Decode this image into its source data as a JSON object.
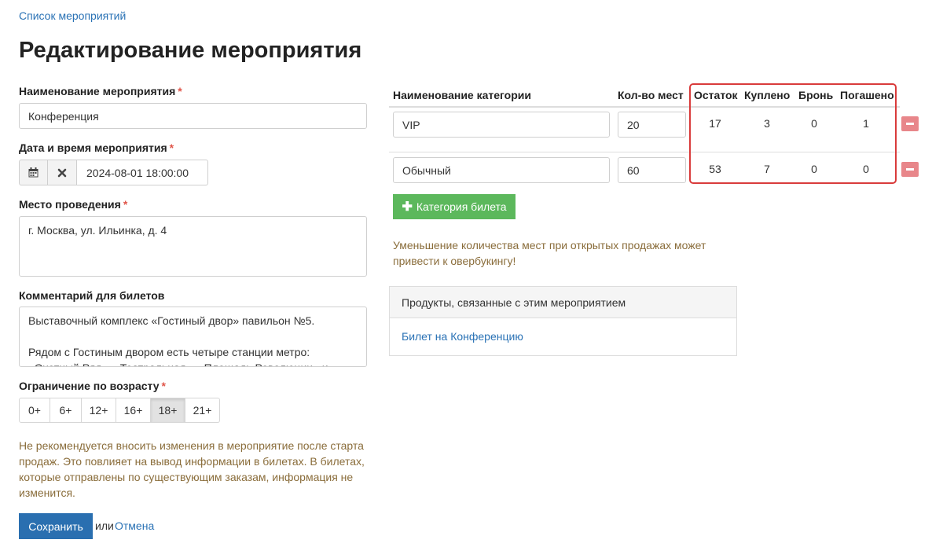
{
  "breadcrumb": "Список мероприятий",
  "page_title": "Редактирование мероприятия",
  "required_mark": "*",
  "form": {
    "name_label": "Наименование мероприятия",
    "name_value": "Конференция",
    "datetime_label": "Дата и время мероприятия",
    "datetime_value": "2024-08-01 18:00:00",
    "calendar_icon": "calendar-icon",
    "clear_icon": "close-icon",
    "venue_label": "Место проведения",
    "venue_value": "г. Москва, ул. Ильинка, д. 4",
    "comment_label": "Комментарий для билетов",
    "comment_value": "Выставочный комплекс «Гостиный двор» павильон №5.\n\nРядом с Гостиным двором есть четыре станции метро: «Охотный Ряд», «Театральная», «Площадь Революции» и «Китай-город».",
    "age_label": "Ограничение по возрасту",
    "age_options": [
      "0+",
      "6+",
      "12+",
      "16+",
      "18+",
      "21+"
    ],
    "age_selected": "18+",
    "warning": "Не рекомендуется вносить изменения в мероприятие после старта продаж. Это повлияет на вывод информации в билетах. В билетах, которые отправлены по существующим заказам, информация не изменится.",
    "save_label": "Сохранить",
    "or_text": "или",
    "cancel_label": "Отмена"
  },
  "categories": {
    "headers": {
      "name": "Наименование категории",
      "seats": "Кол-во мест",
      "remaining": "Остаток",
      "bought": "Куплено",
      "reserved": "Бронь",
      "redeemed": "Погашено"
    },
    "rows": [
      {
        "name": "VIP",
        "seats": "20",
        "remaining": "17",
        "bought": "3",
        "reserved": "0",
        "redeemed": "1"
      },
      {
        "name": "Обычный",
        "seats": "60",
        "remaining": "53",
        "bought": "7",
        "reserved": "0",
        "redeemed": "0"
      }
    ],
    "add_label": "Категория билета",
    "warning": "Уменьшение количества мест при открытых продажах может привести к овербукингу!"
  },
  "products": {
    "title": "Продукты, связанные с этим мероприятием",
    "items": [
      "Билет на Конференцию"
    ]
  },
  "colors": {
    "link": "#2a72b5",
    "primary": "#2a6fb0",
    "success": "#5cb85c",
    "danger": "#e8868a",
    "highlight": "#d93b3b",
    "warning_text": "#8a6d3b"
  }
}
